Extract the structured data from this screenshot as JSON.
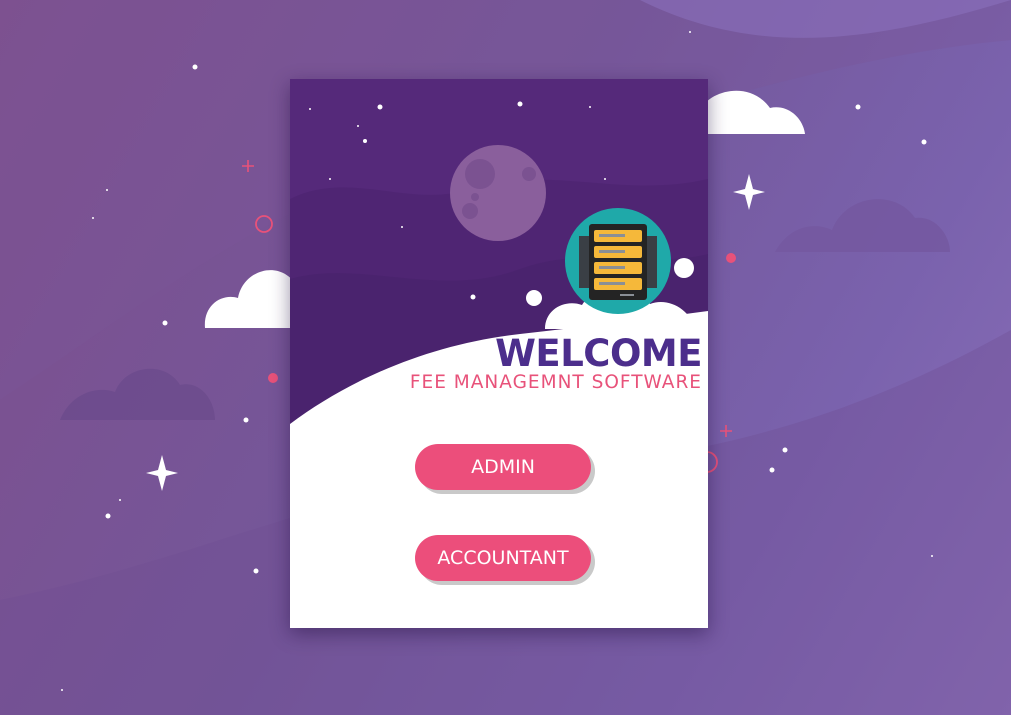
{
  "welcome": {
    "title": "WELCOME",
    "subtitle": "FEE MANAGEMNT SOFTWARE"
  },
  "buttons": {
    "admin": "ADMIN",
    "accountant": "ACCOUNTANT"
  },
  "icons": {
    "app_logo": "server-rack-icon",
    "moon": "moon-icon"
  },
  "colors": {
    "accent": "#ec4e7b",
    "title": "#4c2e8c",
    "card_sky": "#55297a",
    "logo_circle": "#1fa9a9",
    "logo_slots": "#f5b83a"
  }
}
